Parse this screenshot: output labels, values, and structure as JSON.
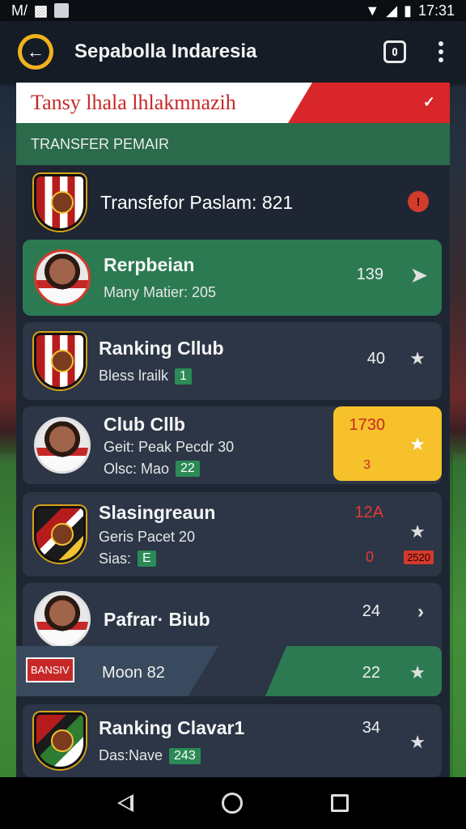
{
  "status": {
    "left_text": "M/",
    "time": "17:31"
  },
  "appbar": {
    "title": "Sepabolla Indaresia"
  },
  "banner": {
    "text": "Tansy lhala lhlakmnazih"
  },
  "section": {
    "label": "TRANSFER PEMAIR"
  },
  "transfer_header": {
    "title": "Transfefor Paslam: 821"
  },
  "rows": [
    {
      "name": "Rerpbeian",
      "sub": "Many Matier: 205",
      "num": "139",
      "action": "arrow"
    },
    {
      "name": "Ranking Cllub",
      "sub": "Bless lrailk",
      "chip": "1",
      "num": "40",
      "action": "star"
    },
    {
      "name": "Club Cllb",
      "sub": "Geit: Peak Pecdr 30",
      "sub2": "Olsc: Mao",
      "chip": "22",
      "num": "1730",
      "num2": "3",
      "action": "star"
    },
    {
      "name": "Slasingreaun",
      "sub": "Geris Pacet 20",
      "sub2": "Sias:",
      "chip": "E",
      "num": "12A",
      "num2": "0",
      "tag": "2520",
      "action": "star"
    },
    {
      "name": "Pafrar· Biub",
      "num": "24",
      "action": "arrow",
      "sub_row": "Moon 82",
      "badge": "BANSIV",
      "sub_num": "22"
    },
    {
      "name": "Ranking Clavar1",
      "sub": "Das:Nave",
      "chip": "243",
      "num": "34",
      "action": "star"
    }
  ],
  "colors": {
    "accent": "#f2b21d",
    "green": "#2b6a4a",
    "red": "#d9262a",
    "highlight": "#f6c12a"
  }
}
